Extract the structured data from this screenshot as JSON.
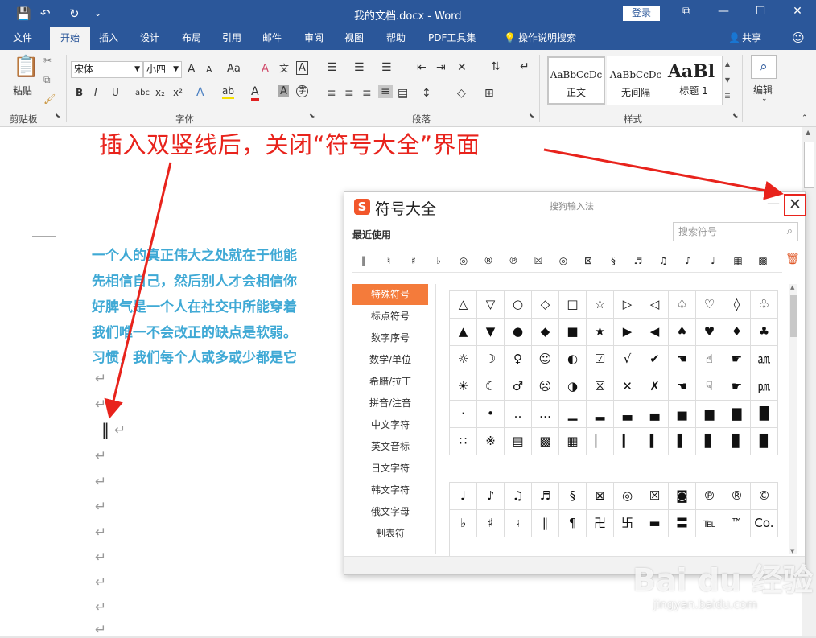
{
  "titlebar": {
    "title": "我的文档.docx - Word",
    "login": "登录",
    "save": "💾",
    "undo": "↶",
    "redo": "↻",
    "customize": "⌄",
    "ribbon_opts": "⧉",
    "minimize": "—",
    "maximize": "☐",
    "close": "✕"
  },
  "tabs": [
    "文件",
    "开始",
    "插入",
    "设计",
    "布局",
    "引用",
    "邮件",
    "审阅",
    "视图",
    "帮助",
    "PDF工具集",
    "操作说明搜索"
  ],
  "share": "共享",
  "ribbon": {
    "clipboard": {
      "paste": "粘贴",
      "group": "剪贴板"
    },
    "font": {
      "name": "宋体",
      "size": "小四",
      "group": "字体",
      "grow": "A",
      "shrink": "A",
      "case": "Aa",
      "clear": "A",
      "phonetic": "文",
      "border": "A",
      "bold": "B",
      "italic": "I",
      "underline": "U",
      "strike": "abc",
      "sub": "x₂",
      "sup": "x²",
      "effects": "A",
      "highlight": "ab",
      "color": "A",
      "shade": "A",
      "circle": "字"
    },
    "paragraph": {
      "group": "段落"
    },
    "styles": {
      "group": "样式",
      "items": [
        {
          "sample": "AaBbCcDc",
          "name": "正文"
        },
        {
          "sample": "AaBbCcDc",
          "name": "无间隔"
        },
        {
          "sample": "AaBl",
          "name": "标题 1"
        }
      ]
    },
    "editing": {
      "label": "编辑",
      "icon": "⌕"
    }
  },
  "document": {
    "paragraphs": [
      "一个人的真正伟大之处就在于他能",
      "先相信自己，然后别人才会相信你",
      "好脾气是一个人在社交中所能穿着",
      "我们唯一不会改正的缺点是软弱。",
      "习惯，我们每个人或多或少都是它"
    ],
    "return_mark": "↵",
    "cursor_symbol": "‖"
  },
  "annotation": {
    "text": "插入双竖线后，关闭“符号大全”界面",
    "color": "#e8231c"
  },
  "dialog": {
    "logo": "S",
    "title": "符号大全",
    "subtitle": "搜狗输入法",
    "minimize": "—",
    "close": "✕",
    "recent_label": "最近使用",
    "search_placeholder": "搜索符号",
    "trash": "🗑",
    "recent": [
      "‖",
      "♮",
      "♯",
      "♭",
      "◎",
      "®",
      "℗",
      "☒",
      "◎",
      "⊠",
      "§",
      "♬",
      "♫",
      "♪",
      "♩",
      "▦",
      "▩"
    ],
    "categories": [
      "特殊符号",
      "标点符号",
      "数字序号",
      "数学/单位",
      "希腊/拉丁",
      "拼音/注音",
      "中文字符",
      "英文音标",
      "日文字符",
      "韩文字符",
      "俄文字母",
      "制表符"
    ],
    "grid1": [
      "△",
      "▽",
      "○",
      "◇",
      "□",
      "☆",
      "▷",
      "◁",
      "♤",
      "♡",
      "◊",
      "♧",
      "▲",
      "▼",
      "●",
      "◆",
      "■",
      "★",
      "▶",
      "◀",
      "♠",
      "♥",
      "♦",
      "♣",
      "☼",
      "☽",
      "♀",
      "☺",
      "◐",
      "☑",
      "√",
      "✔",
      "☚",
      "☝",
      "☛",
      "㏂",
      "☀",
      "☾",
      "♂",
      "☹",
      "◑",
      "☒",
      "✕",
      "✗",
      "☚",
      "☟",
      "☛",
      "㏘",
      "·",
      "•",
      "‥",
      "…",
      "▁",
      "▂",
      "▃",
      "▄",
      "▅",
      "▆",
      "▇",
      "█",
      "∷",
      "※",
      "▤",
      "▩",
      "▦",
      "▏",
      "▎",
      "▍",
      "▌",
      "▋",
      "▊",
      "▉"
    ],
    "grid2": [
      "♩",
      "♪",
      "♫",
      "♬",
      "§",
      "⊠",
      "◎",
      "☒",
      "◙",
      "℗",
      "®",
      "©",
      "♭",
      "♯",
      "♮",
      "‖",
      "¶",
      "卍",
      "卐",
      "▬",
      "〓",
      "℡",
      "™",
      "Co."
    ]
  },
  "watermark": {
    "brand": "Bai du 经验",
    "url": "jingyan.baidu.com"
  }
}
